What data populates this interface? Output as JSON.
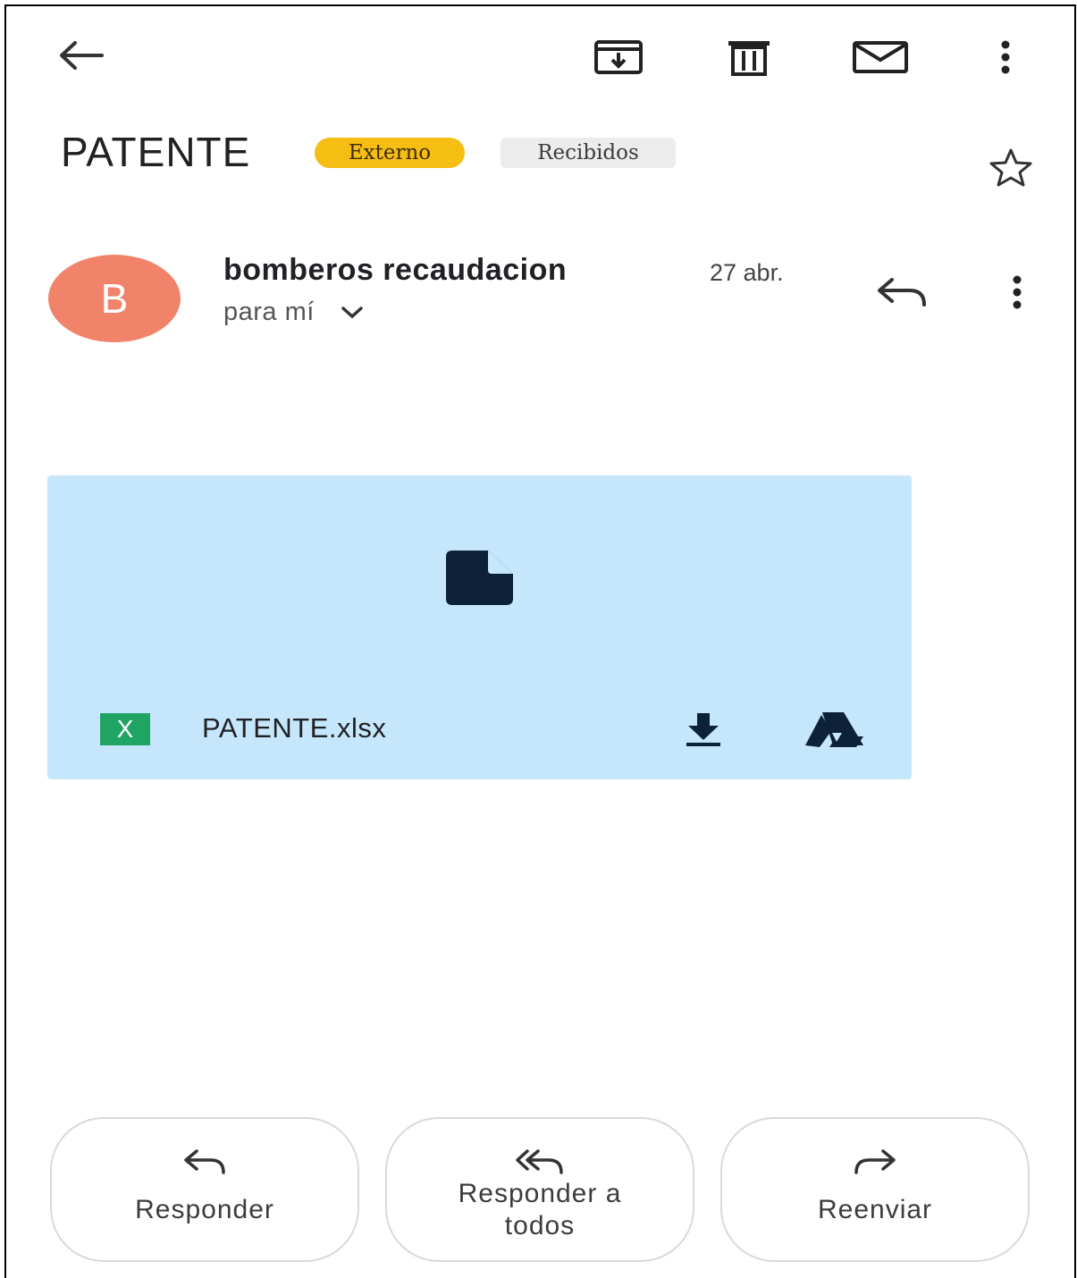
{
  "toolbar": {
    "back_icon": "arrow-left-icon",
    "archive_icon": "archive-icon",
    "delete_icon": "trash-icon",
    "mark_unread_icon": "envelope-icon",
    "more_icon": "more-vertical-icon"
  },
  "email": {
    "subject": "PATENTE",
    "labels": [
      "Externo",
      "Recibidos"
    ],
    "star_icon": "star-outline-icon"
  },
  "message": {
    "avatar_letter": "B",
    "avatar_color": "#f0836a",
    "sender": "bomberos recaudacion",
    "date": "27 abr.",
    "recipient": "para mí",
    "reply_icon": "reply-icon",
    "more_icon": "more-vertical-icon"
  },
  "attachment": {
    "preview_icon": "file-icon",
    "type_badge": "X",
    "filename": "PATENTE.xlsx",
    "download_icon": "download-icon",
    "drive_icon": "google-drive-icon",
    "background": "#c6e6fb"
  },
  "actions": {
    "reply_label": "Responder",
    "reply_all_line1": "Responder a",
    "reply_all_line2": "todos",
    "forward_label": "Reenviar"
  }
}
